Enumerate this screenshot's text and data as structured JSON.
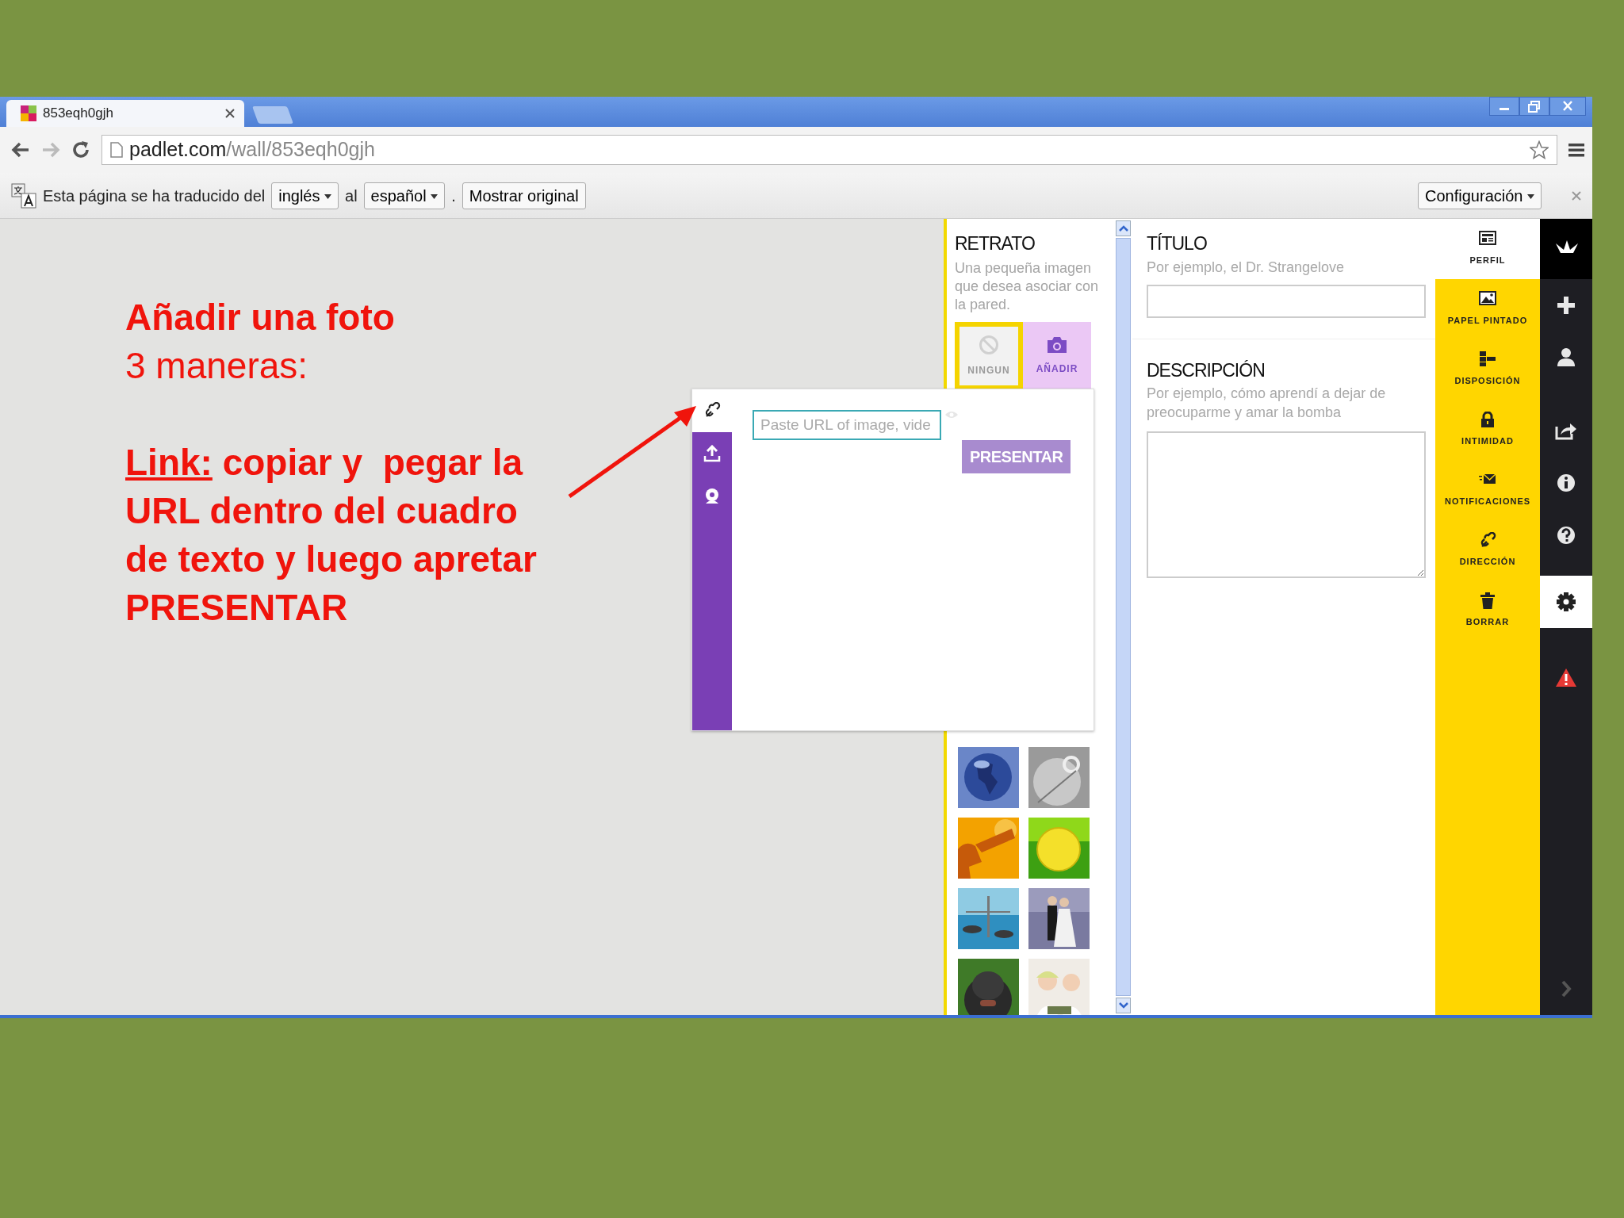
{
  "browser": {
    "tab_title": "853eqh0gjh",
    "url_host": "padlet.com",
    "url_path": "/wall/853eqh0gjh"
  },
  "translate_bar": {
    "message": "Esta página se ha traducido del",
    "from": "inglés",
    "connector": "al",
    "to": "español",
    "period": ".",
    "show_original": "Mostrar original",
    "settings": "Configuración"
  },
  "slide_text": {
    "title": "Añadir una foto",
    "subtitle": "3 maneras:",
    "label": "Link:",
    "lines": [
      "copiar y  pegar la",
      "URL dentro del cuadro",
      "de texto y luego apretar",
      "PRESENTAR"
    ]
  },
  "portrait": {
    "heading": "RETRATO",
    "hint": "Una pequeña imagen que desea asociar con la pared.",
    "options": [
      {
        "kind": "none",
        "label": "NINGUN",
        "selected": true
      },
      {
        "kind": "add",
        "label": "AÑADIR",
        "selected": false
      }
    ]
  },
  "popup": {
    "tabs": [
      {
        "kind": "link",
        "selected": true
      },
      {
        "kind": "upload",
        "selected": false
      },
      {
        "kind": "webcam",
        "selected": false
      }
    ],
    "url_field": {
      "placeholder": "Paste URL of image, vide"
    },
    "submit": {
      "label": "PRESENTAR",
      "disabled": true
    }
  },
  "settings": {
    "title_label": "TÍTULO",
    "title_hint": "Por ejemplo, el Dr. Strangelove",
    "description_label": "DESCRIPCIÓN",
    "description_hint": "Por ejemplo, cómo aprendí a dejar de preocuparme y amar la bomba"
  },
  "menu": [
    {
      "kind": "profile",
      "label": "PERFIL",
      "selected": true
    },
    {
      "kind": "wallpaper",
      "label": "PAPEL PINTADO",
      "selected": false
    },
    {
      "kind": "layout",
      "label": "DISPOSICIÓN",
      "selected": false
    },
    {
      "kind": "privacy",
      "label": "INTIMIDAD",
      "selected": false
    },
    {
      "kind": "notifications",
      "label": "NOTIFICACIONES",
      "selected": false
    },
    {
      "kind": "address",
      "label": "DIRECCIÓN",
      "selected": false
    },
    {
      "kind": "delete",
      "label": "BORRAR",
      "selected": false
    }
  ],
  "sidebar": [
    {
      "kind": "logo",
      "selected": false
    },
    {
      "kind": "add",
      "selected": false
    },
    {
      "kind": "user",
      "selected": false
    },
    {
      "kind": "share",
      "selected": false
    },
    {
      "kind": "info",
      "selected": false
    },
    {
      "kind": "help",
      "selected": false
    },
    {
      "kind": "settings",
      "selected": true
    },
    {
      "kind": "alert",
      "selected": false
    },
    {
      "kind": "next",
      "selected": false
    }
  ]
}
